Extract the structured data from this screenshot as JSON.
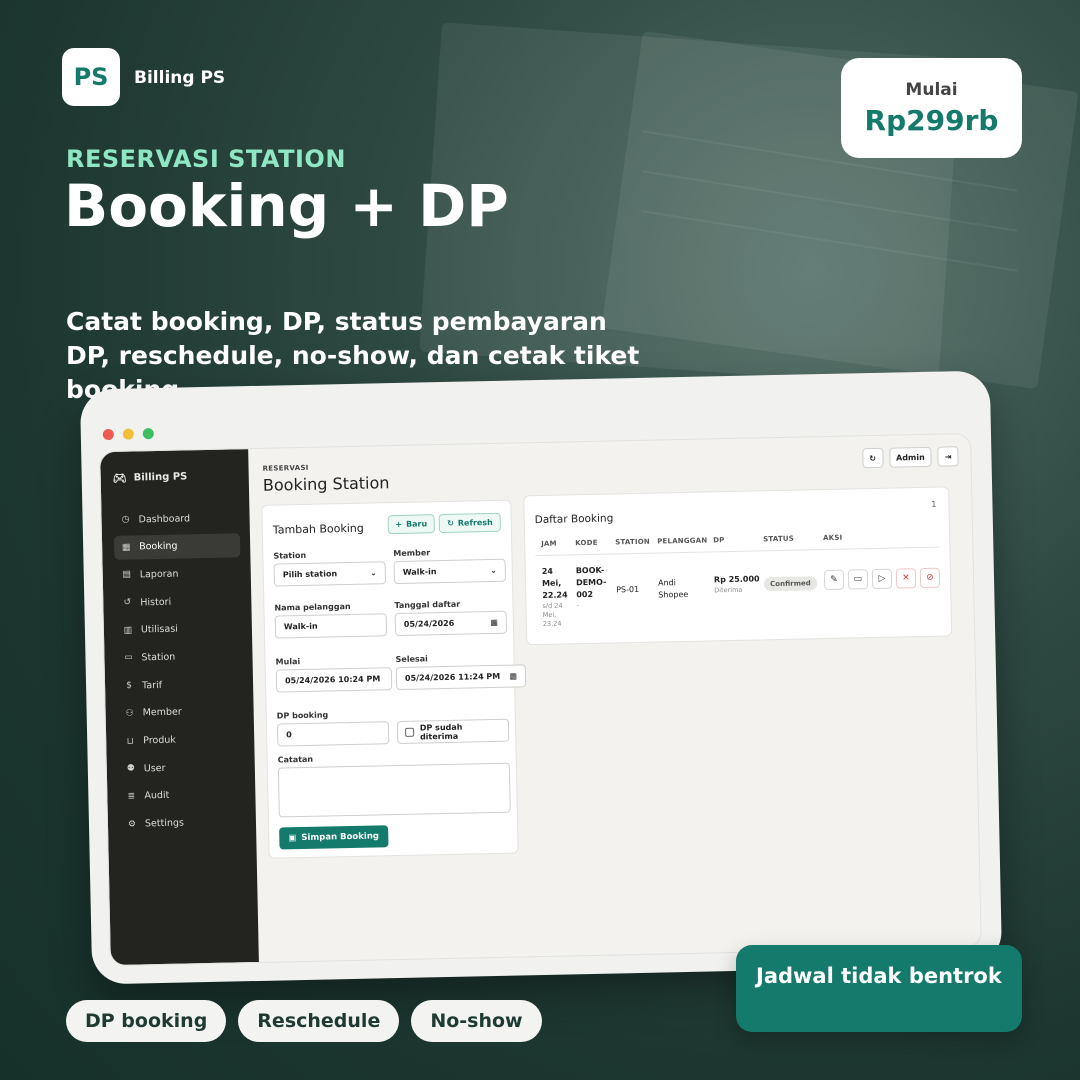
{
  "brand": {
    "logo_text": "PS",
    "name": "Billing PS"
  },
  "price": {
    "label": "Mulai",
    "value": "Rp299rb"
  },
  "hero": {
    "eyebrow": "RESERVASI STATION",
    "headline": "Booking + DP",
    "description": "Catat booking, DP, status pembayaran DP, reschedule, no-show, dan cetak tiket booking."
  },
  "app": {
    "sidebar": {
      "brand": "Billing PS",
      "items": [
        {
          "label": "Dashboard",
          "icon": "clock-icon"
        },
        {
          "label": "Booking",
          "icon": "calendar-icon",
          "active": true
        },
        {
          "label": "Laporan",
          "icon": "document-icon"
        },
        {
          "label": "Histori",
          "icon": "history-icon"
        },
        {
          "label": "Utilisasi",
          "icon": "bar-chart-icon"
        },
        {
          "label": "Station",
          "icon": "gamepad-icon"
        },
        {
          "label": "Tarif",
          "icon": "dollar-icon"
        },
        {
          "label": "Member",
          "icon": "users-icon"
        },
        {
          "label": "Produk",
          "icon": "cart-icon"
        },
        {
          "label": "User",
          "icon": "user-gear-icon"
        },
        {
          "label": "Audit",
          "icon": "audit-icon"
        },
        {
          "label": "Settings",
          "icon": "gear-icon"
        }
      ]
    },
    "header": {
      "breadcrumb": "RESERVASI",
      "title": "Booking Station",
      "user_label": "Admin"
    },
    "form": {
      "title": "Tambah Booking",
      "new_label": "Baru",
      "refresh_label": "Refresh",
      "station_label": "Station",
      "station_value": "Pilih station",
      "member_label": "Member",
      "member_value": "Walk-in",
      "name_label": "Nama pelanggan",
      "name_value": "Walk-in",
      "date_label": "Tanggal daftar",
      "date_value": "05/24/2026",
      "start_label": "Mulai",
      "start_value": "05/24/2026 10:24 PM",
      "end_label": "Selesai",
      "end_value": "05/24/2026 11:24 PM",
      "dp_label": "DP booking",
      "dp_value": "0",
      "dp_received_label": "DP sudah diterima",
      "notes_label": "Catatan",
      "save_label": "Simpan Booking"
    },
    "list": {
      "title": "Daftar Booking",
      "count": "1",
      "columns": [
        "JAM",
        "KODE",
        "STATION",
        "PELANGGAN",
        "DP",
        "STATUS",
        "AKSI"
      ],
      "rows": [
        {
          "time": "24 Mei, 22.24",
          "time_to": "s/d 24 Mei, 23.24",
          "code": "BOOK-DEMO-002",
          "code_sub": "-",
          "station": "PS-01",
          "customer": "Andi Shopee",
          "dp": "Rp 25.000",
          "dp_sub": "Diterima",
          "status": "Confirmed"
        }
      ]
    }
  },
  "callout": "Jadwal tidak bentrok",
  "chips": [
    "DP booking",
    "Reschedule",
    "No-show"
  ],
  "colors": {
    "accent": "#137a6c",
    "eyebrow": "#8ee6c2",
    "sidebar": "#23241f"
  }
}
